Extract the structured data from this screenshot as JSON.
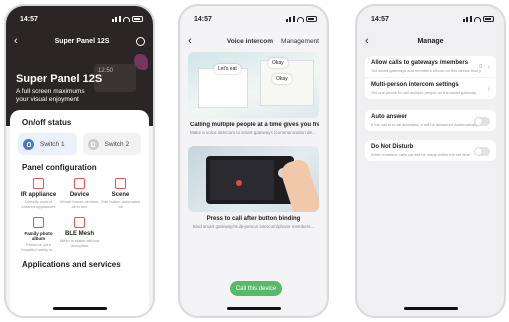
{
  "screen1": {
    "status_time": "14:57",
    "title": "Super Panel 12S",
    "hero_title": "Super Panel 12S",
    "hero_subtitle": "A full screen maximums your visual enjoyment",
    "hero_panel_time": "12:50",
    "onoff_title": "On/off status",
    "switches": [
      {
        "label": "Switch 1",
        "state": "on"
      },
      {
        "label": "Switch 2",
        "state": "off"
      }
    ],
    "panel_config_title": "Panel configuration",
    "config_items": [
      {
        "name": "IR appliance",
        "desc": "Directly control infrared appliances",
        "icon": "ir-icon"
      },
      {
        "name": "Device",
        "desc": "Whole-house devices, all in one",
        "icon": "device-icon"
      },
      {
        "name": "Scene",
        "desc": "One button automates all",
        "icon": "scene-icon"
      },
      {
        "name": "Family photo album",
        "desc": "Preserve your beautiful family m...",
        "icon": "photo-icon"
      },
      {
        "name": "BLE Mesh",
        "desc": "Mesh is stable without disruption",
        "icon": "mesh-icon"
      }
    ],
    "apps_title": "Applications and services"
  },
  "screen2": {
    "status_time": "14:57",
    "title": "Voice intercom",
    "tab_manage": "Management",
    "bubble1": "Let's eat",
    "bubble2": "Okay",
    "bubble3": "Okay",
    "caption1": "Calling multiple people at a time gives you freed...",
    "caption1_sub": "Make a voice intercom to smart gateways (communication de...",
    "caption2": "Press to call after button binding",
    "caption2_sub": "Bind smart gateway/multi-person intercom/phone members...",
    "call_button": "Call this device"
  },
  "screen3": {
    "status_time": "14:57",
    "title": "Manage",
    "items": [
      {
        "title": "Allow calls to gateways /members",
        "desc": "Set smart gateways and members shown on this device that you",
        "value": "0",
        "control": "chevron"
      },
      {
        "title": "Multi-person intercom settings",
        "desc": "Set one phone to call multiple people on the smart gateway",
        "value": "",
        "control": "chevron"
      },
      {
        "title": "Auto answer",
        "desc": "If the call is to be accepted, it will be answered automatically",
        "value": "",
        "control": "toggle"
      },
      {
        "title": "Do Not Disturb",
        "desc": "When enabled, calls cannot be made within the set time",
        "value": "",
        "control": "toggle"
      }
    ]
  },
  "colors": {
    "accent_green": "#59b86a",
    "switch_on": "#4a78c9",
    "config_icon": "#e05555",
    "hero_bg": "#2a2626"
  }
}
